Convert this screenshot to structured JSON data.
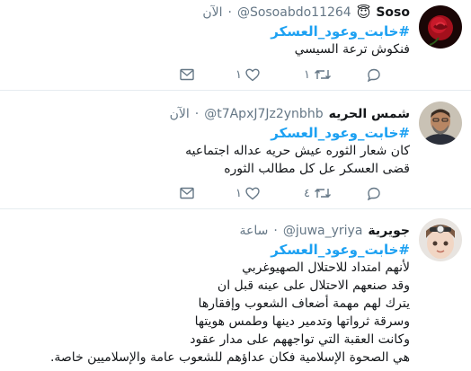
{
  "tweets": [
    {
      "name": "Soso",
      "name_emoji": "😇",
      "handle": "@Sosoabdo11264",
      "dot": "·",
      "time": "الآن",
      "hashtag": "#خابت_وعود_العسكر",
      "lines": [
        "فنكوش ترعة السيسي"
      ],
      "replies": "",
      "retweets": "١",
      "likes": "١",
      "avatar_icon": "red-rose-avatar"
    },
    {
      "name": "شمس الحريه",
      "name_emoji": "",
      "handle": "@t7ApxJ7Jz2ynbhb",
      "dot": "·",
      "time": "الآن",
      "hashtag": "#خابت_وعود_العسكر",
      "lines": [
        "كان شعار الثوره عيش حريه عداله اجتماعيه",
        "قضى العسكر عل كل مطالب الثوره"
      ],
      "replies": "",
      "retweets": "٤",
      "likes": "١",
      "avatar_icon": "man-portrait-avatar"
    },
    {
      "name": "جويرية",
      "name_emoji": "",
      "handle": "@juwa_yriya",
      "dot": "·",
      "time": "ساعة",
      "hashtag": "#خابت_وعود_العسكر",
      "lines": [
        "لأنهم امتداد للاحتلال الصهيوغربي",
        "وقد صنعهم الاحتلال على عينه قبل ان",
        "يترك لهم مهمة أضعاف الشعوب وإفقارها",
        "وسرقة ثرواتها وتدمير دينها وطمس هويتها",
        "وكانت العقبة التي تواجههم على مدار عقود",
        "هي الصحوة الإسلامية فكان عداؤهم للشعوب عامة والإسلاميين خاصة."
      ],
      "replies": "",
      "retweets": "",
      "likes": "",
      "avatar_icon": "child-portrait-avatar"
    }
  ],
  "colors": {
    "link": "#1da1f2",
    "muted": "#657786",
    "divider": "#e6ecf0"
  }
}
